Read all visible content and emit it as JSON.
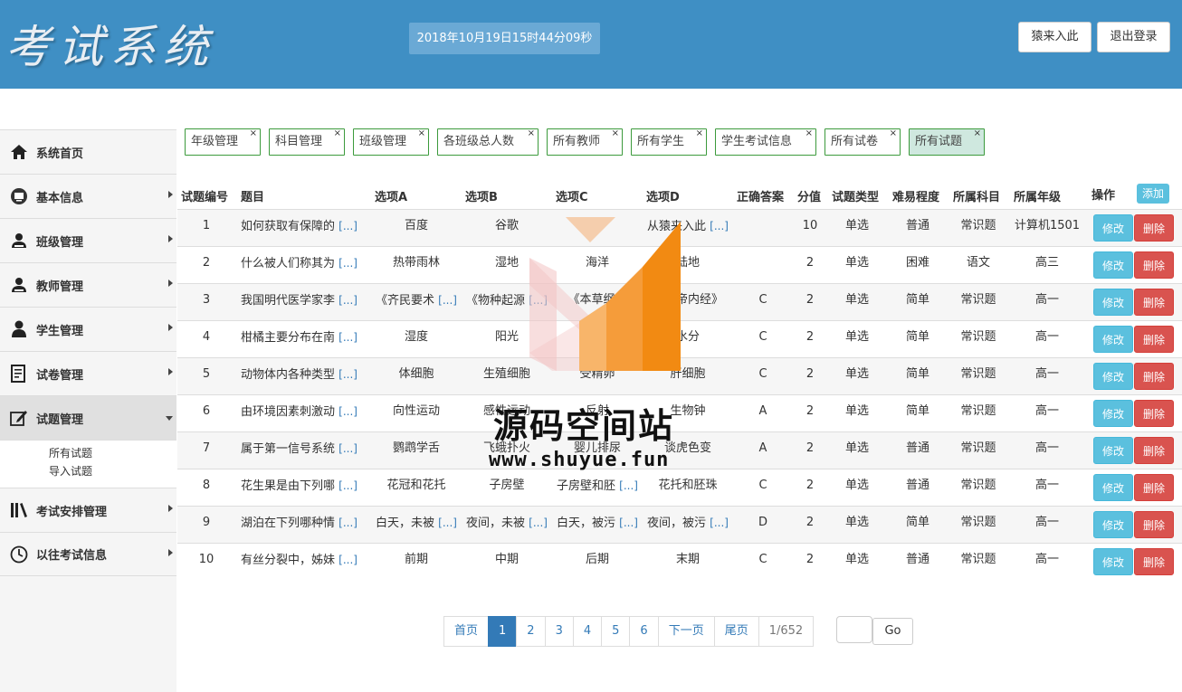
{
  "header": {
    "logo": "考试系统",
    "clock": "2018年10月19日15时44分09秒",
    "user_button": "猿来入此",
    "logout_button": "退出登录"
  },
  "sidebar": {
    "items": [
      {
        "label": "系统首页",
        "icon": "home-icon"
      },
      {
        "label": "基本信息",
        "icon": "info-icon"
      },
      {
        "label": "班级管理",
        "icon": "user-icon"
      },
      {
        "label": "教师管理",
        "icon": "user-icon"
      },
      {
        "label": "学生管理",
        "icon": "person-icon"
      },
      {
        "label": "试卷管理",
        "icon": "document-icon"
      },
      {
        "label": "试题管理",
        "icon": "edit-icon"
      },
      {
        "label": "考试安排管理",
        "icon": "books-icon"
      },
      {
        "label": "以往考试信息",
        "icon": "clock-icon"
      }
    ],
    "sub_items": [
      "所有试题",
      "导入试题"
    ]
  },
  "tabs": [
    "年级管理",
    "科目管理",
    "班级管理",
    "各班级总人数",
    "所有教师",
    "所有学生",
    "学生考试信息",
    "所有试卷",
    "所有试题"
  ],
  "tab_close": "×",
  "table": {
    "headers": [
      "试题编号",
      "题目",
      "选项A",
      "选项B",
      "选项C",
      "选项D",
      "正确答案",
      "分值",
      "试题类型",
      "难易程度",
      "所属科目",
      "所属年级",
      "操作"
    ],
    "add_label": "添加",
    "more": "[...]",
    "edit_label": "修改",
    "delete_label": "删除",
    "rows": [
      {
        "id": "1",
        "title": "如何获取有保障的",
        "a": "百度",
        "b": "谷歌",
        "c": "",
        "d": "从猿来入此",
        "ans": "",
        "score": "10",
        "type": "单选",
        "level": "普通",
        "subject": "常识题",
        "grade": "计算机1501"
      },
      {
        "id": "2",
        "title": "什么被人们称其为",
        "a": "热带雨林",
        "b": "湿地",
        "c": "海洋",
        "d": "陆地",
        "ans": "",
        "score": "2",
        "type": "单选",
        "level": "困难",
        "subject": "语文",
        "grade": "高三"
      },
      {
        "id": "3",
        "title": "我国明代医学家李",
        "a": "《齐民要术",
        "b": "《物种起源",
        "c": "《本草纲目",
        "d": "《黄帝内经》",
        "ans": "C",
        "score": "2",
        "type": "单选",
        "level": "简单",
        "subject": "常识题",
        "grade": "高一"
      },
      {
        "id": "4",
        "title": "柑橘主要分布在南",
        "a": "湿度",
        "b": "阳光",
        "c": "温度",
        "d": "水分",
        "ans": "C",
        "score": "2",
        "type": "单选",
        "level": "简单",
        "subject": "常识题",
        "grade": "高一"
      },
      {
        "id": "5",
        "title": "动物体内各种类型",
        "a": "体细胞",
        "b": "生殖细胞",
        "c": "受精卵",
        "d": "肝细胞",
        "ans": "C",
        "score": "2",
        "type": "单选",
        "level": "简单",
        "subject": "常识题",
        "grade": "高一"
      },
      {
        "id": "6",
        "title": "由环境因素刺激动",
        "a": "向性运动",
        "b": "感性运动",
        "c": "反射",
        "d": "生物钟",
        "ans": "A",
        "score": "2",
        "type": "单选",
        "level": "简单",
        "subject": "常识题",
        "grade": "高一"
      },
      {
        "id": "7",
        "title": "属于第一信号系统",
        "a": "鹦鹉学舌",
        "b": "飞蛾扑火",
        "c": "婴儿排尿",
        "d": "谈虎色变",
        "ans": "A",
        "score": "2",
        "type": "单选",
        "level": "普通",
        "subject": "常识题",
        "grade": "高一"
      },
      {
        "id": "8",
        "title": "花生果是由下列哪",
        "a": "花冠和花托",
        "b": "子房壁",
        "c": "子房壁和胚",
        "d": "花托和胚珠",
        "ans": "C",
        "score": "2",
        "type": "单选",
        "level": "普通",
        "subject": "常识题",
        "grade": "高一"
      },
      {
        "id": "9",
        "title": "湖泊在下列哪种情",
        "a": "白天，未被",
        "b": "夜间，未被",
        "c": "白天，被污",
        "d": "夜间，被污",
        "ans": "D",
        "score": "2",
        "type": "单选",
        "level": "简单",
        "subject": "常识题",
        "grade": "高一"
      },
      {
        "id": "10",
        "title": "有丝分裂中，姊妹",
        "a": "前期",
        "b": "中期",
        "c": "后期",
        "d": "末期",
        "ans": "C",
        "score": "2",
        "type": "单选",
        "level": "普通",
        "subject": "常识题",
        "grade": "高一"
      }
    ],
    "more_flags": {
      "a": [
        false,
        false,
        true,
        false,
        false,
        false,
        false,
        false,
        true,
        false
      ],
      "b": [
        false,
        false,
        true,
        false,
        false,
        false,
        false,
        false,
        true,
        false
      ],
      "c": [
        false,
        false,
        false,
        false,
        false,
        false,
        false,
        true,
        true,
        false
      ],
      "d": [
        true,
        false,
        false,
        false,
        false,
        false,
        false,
        false,
        true,
        false
      ]
    }
  },
  "pagination": {
    "items": [
      "首页",
      "1",
      "2",
      "3",
      "4",
      "5",
      "6",
      "下一页",
      "尾页",
      "1/652"
    ],
    "active": "1",
    "go_label": "Go"
  },
  "watermark": {
    "text": "源码空间站",
    "url": "www.shuyue.fun"
  },
  "colors": {
    "header_bg": "#3f8fc4",
    "tab_border": "#3c9a3c",
    "edit_btn": "#5bc0de",
    "delete_btn": "#d9534f",
    "pager_active": "#337ab7"
  }
}
